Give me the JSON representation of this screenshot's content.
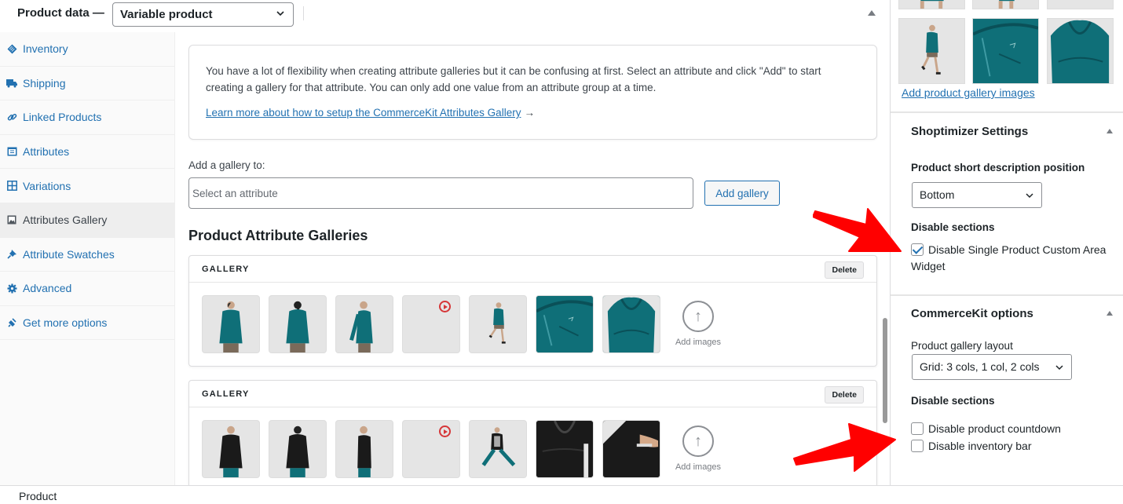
{
  "header": {
    "title": "Product data —",
    "product_type": "Variable product"
  },
  "sidebar": {
    "items": [
      {
        "label": "Inventory",
        "icon": "tag-icon",
        "active": false
      },
      {
        "label": "Shipping",
        "icon": "truck-icon",
        "active": false
      },
      {
        "label": "Linked Products",
        "icon": "link-icon",
        "active": false
      },
      {
        "label": "Attributes",
        "icon": "list-icon",
        "active": false
      },
      {
        "label": "Variations",
        "icon": "grid-icon",
        "active": false
      },
      {
        "label": "Attributes Gallery",
        "icon": "image-icon",
        "active": true
      },
      {
        "label": "Attribute Swatches",
        "icon": "pin-icon",
        "active": false
      },
      {
        "label": "Advanced",
        "icon": "gear-icon",
        "active": false
      },
      {
        "label": "Get more options",
        "icon": "plugin-icon",
        "active": false
      }
    ]
  },
  "main": {
    "info_text": "You have a lot of flexibility when creating attribute galleries but it can be confusing at first. Select an attribute and click \"Add\" to start creating a gallery for that attribute. You can only add one value from an attribute group at a time.",
    "info_link": "Learn more about how to setup the CommerceKit Attributes Gallery",
    "info_arrow": "→",
    "add_label": "Add a gallery to:",
    "attribute_placeholder": "Select an attribute",
    "add_gallery_button": "Add gallery",
    "section_title": "Product Attribute Galleries",
    "galleries": [
      {
        "title": "GALLERY",
        "delete_label": "Delete",
        "color": "teal",
        "thumbnails": [
          "front",
          "back",
          "side",
          "video",
          "running",
          "back-detail",
          "back-hood"
        ],
        "add_images_label": "Add images"
      },
      {
        "title": "GALLERY",
        "delete_label": "Delete",
        "color": "black",
        "thumbnails": [
          "front",
          "back",
          "side",
          "video",
          "stretch",
          "back-detail",
          "pocket"
        ],
        "add_images_label": "Add images"
      }
    ]
  },
  "right": {
    "add_gallery_images_link": "Add product gallery images",
    "shoptimizer": {
      "title": "Shoptimizer Settings",
      "desc_position_label": "Product short description position",
      "desc_position_value": "Bottom",
      "disable_label": "Disable sections",
      "checkbox_label": "Disable Single Product Custom Area Widget",
      "checkbox_checked": true
    },
    "commercekit": {
      "title": "CommerceKit options",
      "layout_label": "Product gallery layout",
      "layout_value": "Grid: 3 cols, 1 col, 2 cols",
      "disable_label": "Disable sections",
      "checkboxes": [
        {
          "label": "Disable product countdown",
          "checked": false
        },
        {
          "label": "Disable inventory bar",
          "checked": false
        }
      ]
    }
  },
  "footer": {
    "label": "Product"
  },
  "colors": {
    "link": "#2271b1",
    "annotation_arrow": "#ff0000",
    "teal_jacket": "#0f6f78",
    "black_jacket": "#1a1a1a",
    "video_icon": "#d63638"
  }
}
